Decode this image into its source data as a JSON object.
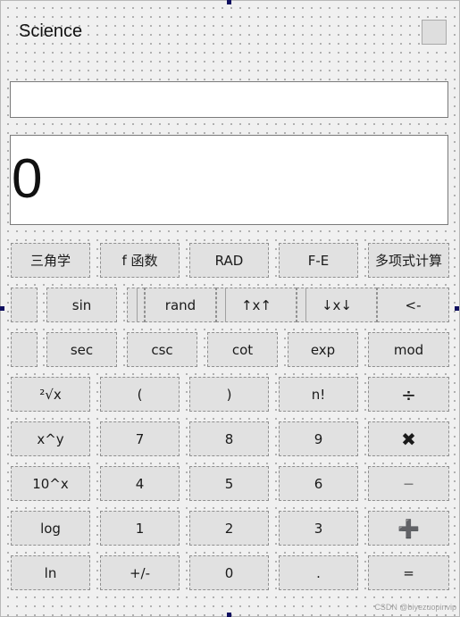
{
  "window": {
    "title": "Science"
  },
  "display": {
    "expression": "",
    "value": "0"
  },
  "mode_row": [
    "三角学",
    "f 函数",
    "RAD",
    "F-E",
    "多项式计算"
  ],
  "func_row_1": [
    "sin",
    "rand",
    "↑x↑",
    "↓x↓",
    "<-"
  ],
  "func_row_2": [
    "sec",
    "csc",
    "cot",
    "exp",
    "mod"
  ],
  "keypad": {
    "row3": [
      "²√x",
      "(",
      ")",
      "n!",
      "÷"
    ],
    "row4": [
      "x^y",
      "7",
      "8",
      "9",
      "✖"
    ],
    "row5": [
      "10^x",
      "4",
      "5",
      "6",
      "—"
    ],
    "row6": [
      "log",
      "1",
      "2",
      "3",
      "➕"
    ],
    "row7": [
      "ln",
      "+/-",
      "0",
      ".",
      "="
    ]
  },
  "watermark": "CSDN @biyezuopinvip"
}
